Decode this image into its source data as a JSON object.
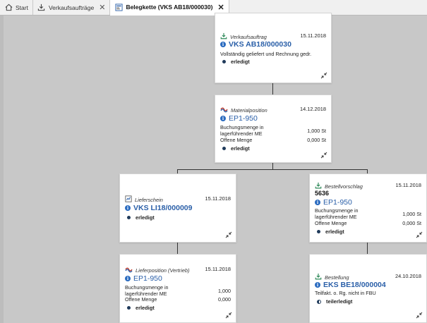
{
  "tabs": [
    {
      "label": "Start",
      "icon": "home-icon"
    },
    {
      "label": "Verkaufsaufträge",
      "icon": "download-icon"
    },
    {
      "label": "Belegkette (VKS AB18/000030)",
      "icon": "document-chain-icon"
    }
  ],
  "cards": {
    "verkaufsauftrag": {
      "type": "Verkaufsauftrag",
      "date": "15.11.2018",
      "title": "VKS AB18/000030",
      "subtitle": "Vollständig geliefert und Rechnung gedr.",
      "status": "erledigt"
    },
    "materialposition": {
      "type": "Materialposition",
      "date": "14.12.2018",
      "title": "EP1-950",
      "qty_label": "Buchungsmenge in lagerführender ME",
      "qty_value": "1,000 St",
      "open_label": "Offene Menge",
      "open_value": "0,000 St",
      "status": "erledigt"
    },
    "lieferschein": {
      "type": "Lieferschein",
      "date": "15.11.2018",
      "title": "VKS LI18/000009",
      "status": "erledigt"
    },
    "bestellvorschlag": {
      "type": "Bestellvorschlag",
      "date": "15.11.2018",
      "number": "5636",
      "title": "EP1-950",
      "qty_label": "Buchungsmenge in lagerführender ME",
      "qty_value": "1,000 St",
      "open_label": "Offene Menge",
      "open_value": "0,000 St",
      "status": "erledigt"
    },
    "lieferposition": {
      "type": "Lieferposition (Vertrieb)",
      "date": "15.11.2018",
      "title": "EP1-950",
      "qty_label": "Buchungsmenge in lagerführender ME",
      "qty_value": "1,000",
      "open_label": "Offene Menge",
      "open_value": "0,000",
      "status": "erledigt"
    },
    "bestellung": {
      "type": "Bestellung",
      "date": "24.10.2018",
      "title": "EKS BE18/000004",
      "subtitle": "Teilfakt. o. Rg. nicht in FBU",
      "status": "teilerledigt"
    }
  },
  "colors": {
    "accent": "#2a5fa8",
    "background": "#c8c8c8",
    "card": "#ffffff"
  }
}
